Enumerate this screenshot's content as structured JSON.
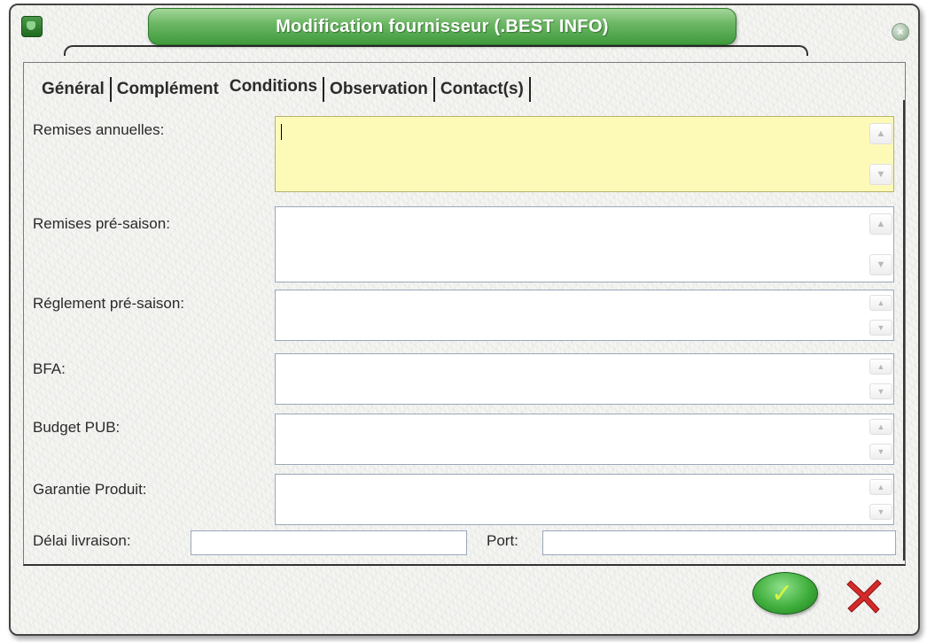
{
  "window": {
    "title": "Modification fournisseur  (.BEST INFO)"
  },
  "tabs": [
    {
      "label": "Général"
    },
    {
      "label": "Complément"
    },
    {
      "label": "Conditions"
    },
    {
      "label": "Observation"
    },
    {
      "label": "Contact(s)"
    }
  ],
  "active_tab": "Conditions",
  "fields": {
    "remises_annuelles": {
      "label": "Remises annuelles:",
      "value": ""
    },
    "remises_pre_saison": {
      "label": "Remises pré-saison:",
      "value": ""
    },
    "reglement_pre_saison": {
      "label": "Réglement pré-saison:",
      "value": ""
    },
    "bfa": {
      "label": "BFA:",
      "value": ""
    },
    "budget_pub": {
      "label": "Budget PUB:",
      "value": ""
    },
    "garantie_produit": {
      "label": "Garantie Produit:",
      "value": ""
    },
    "delai_livraison": {
      "label": "Délai livraison:",
      "value": ""
    },
    "port": {
      "label": "Port:",
      "value": ""
    }
  },
  "colors": {
    "title_green": "#4fa84a",
    "focused_field": "#fdfab8",
    "cancel_red": "#d42a2a",
    "ok_check": "#d7f542"
  },
  "icons": {
    "app": "app-icon",
    "close": "close-icon",
    "ok": "checkmark-icon",
    "cancel": "cross-icon"
  }
}
